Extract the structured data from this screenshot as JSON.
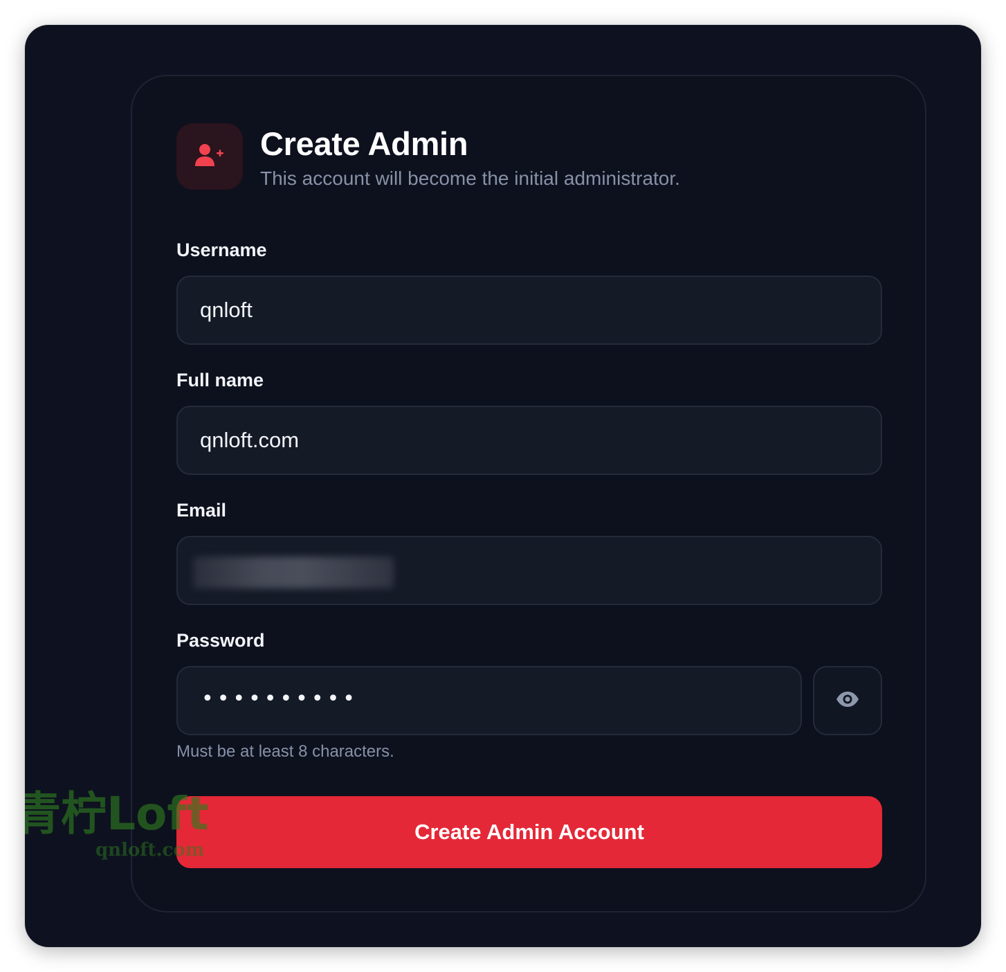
{
  "header": {
    "title": "Create Admin",
    "subtitle": "This account will become the initial administrator.",
    "icon": "user-plus-icon",
    "accent_color": "#f2424f"
  },
  "form": {
    "username": {
      "label": "Username",
      "value": "qnloft"
    },
    "full_name": {
      "label": "Full name",
      "value": "qnloft.com"
    },
    "email": {
      "label": "Email",
      "value_redacted": true
    },
    "password": {
      "label": "Password",
      "masked_value": "••••••••••",
      "toggle_icon": "eye-icon",
      "hint": "Must be at least 8 characters."
    },
    "submit_label": "Create Admin Account"
  },
  "watermark": {
    "text": "青柠Loft",
    "subtext": "qnloft.com"
  },
  "colors": {
    "background": "#0e1220",
    "card": "#0d111d",
    "field": "#151a27",
    "button": "#e52837",
    "muted_text": "#8791a8"
  }
}
